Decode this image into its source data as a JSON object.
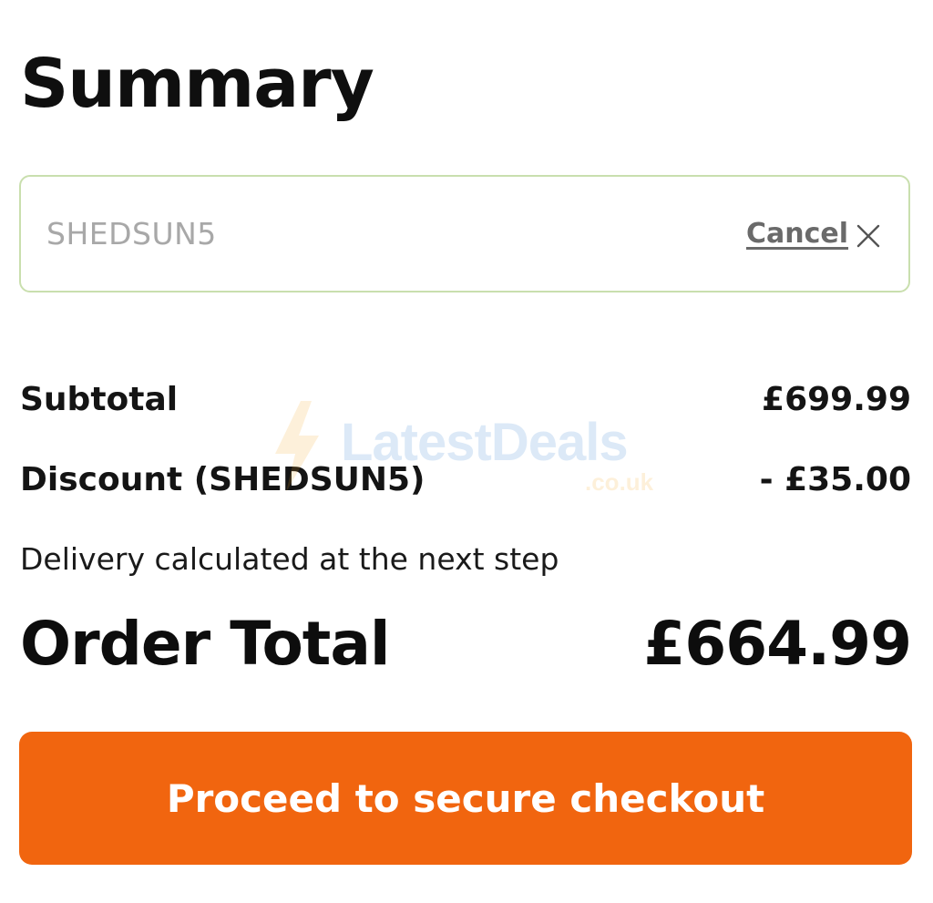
{
  "summary": {
    "title": "Summary"
  },
  "promo": {
    "code": "SHEDSUN5",
    "cancel_label": "Cancel",
    "border_color": "#c9dfae"
  },
  "totals": {
    "subtotal_label": "Subtotal",
    "subtotal_value": "£699.99",
    "discount_label": "Discount (SHEDSUN5)",
    "discount_value": "- £35.00",
    "delivery_note": "Delivery calculated at the next step",
    "order_total_label": "Order Total",
    "order_total_value": "£664.99"
  },
  "checkout": {
    "button_label": "Proceed to secure checkout",
    "button_color": "#f1650f"
  },
  "watermark": {
    "text": "LatestDeals",
    "sub": ".co.uk",
    "icon": "lightning-bolt-icon"
  }
}
